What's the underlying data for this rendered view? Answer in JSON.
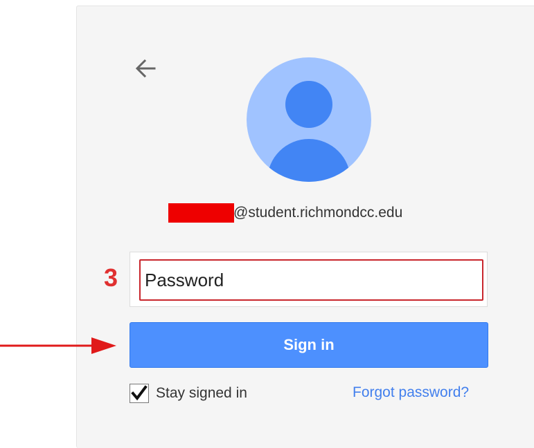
{
  "account": {
    "email_suffix": "@student.richmondcc.edu"
  },
  "password_field": {
    "placeholder": "Password",
    "value": ""
  },
  "annotation": {
    "step_number": "3"
  },
  "sign_in_button": {
    "label": "Sign in"
  },
  "stay_signed_in": {
    "label": "Stay signed in",
    "checked": true
  },
  "forgot_password": {
    "label": "Forgot password?"
  },
  "colors": {
    "primary_button": "#4d90fe",
    "link": "#427fed",
    "annotation_red": "#e03030",
    "avatar_light": "#a0c3ff",
    "avatar_dark": "#4285f4"
  },
  "icons": {
    "back": "arrow-left",
    "avatar": "default-person-silhouette",
    "checkbox": "check-mark",
    "annotation_arrow": "arrow-right"
  }
}
